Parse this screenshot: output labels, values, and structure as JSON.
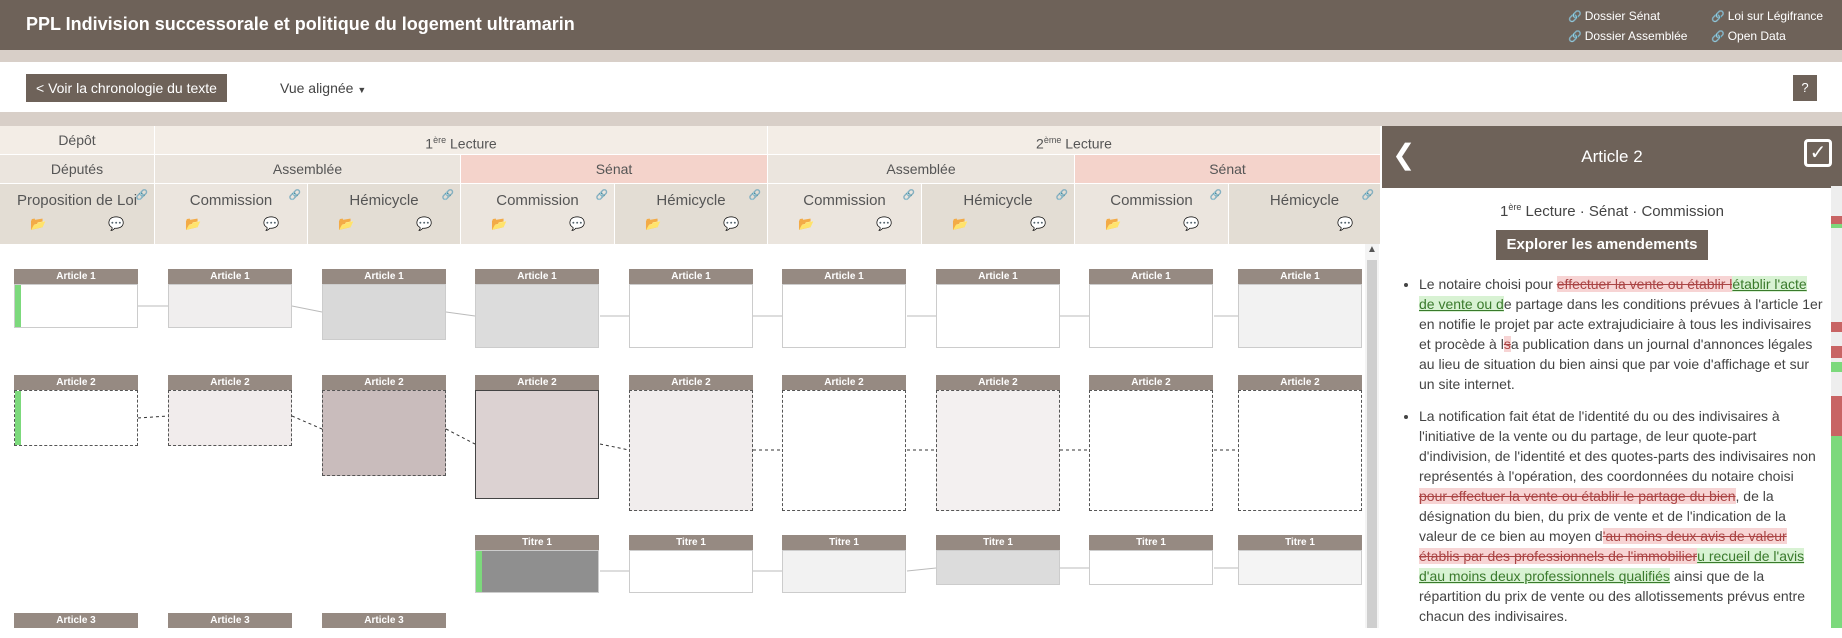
{
  "header": {
    "title": "PPL Indivision successorale et politique du logement ultramarin",
    "links": [
      "Dossier Sénat",
      "Dossier Assemblée",
      "Loi sur Légifrance",
      "Open Data"
    ]
  },
  "toolbar": {
    "back_label": "< Voir la chronologie du texte",
    "view_label": "Vue alignée",
    "help_label": "?"
  },
  "columns": {
    "row1": [
      {
        "label": "Dépôt"
      },
      {
        "label": "1ère Lecture",
        "base": "1",
        "sup": "ère",
        "rest": " Lecture"
      },
      {
        "label": "2ème Lecture",
        "base": "2",
        "sup": "ème",
        "rest": " Lecture"
      }
    ],
    "row2": [
      "Députés",
      "Assemblée",
      "Sénat",
      "Assemblée",
      "Sénat"
    ],
    "row3": [
      "Proposition de Loi",
      "Commission",
      "Hémicycle",
      "Commission",
      "Hémicycle",
      "Commission",
      "Hémicycle",
      "Commission",
      "Hémicycle"
    ]
  },
  "grid": {
    "article1": "Article 1",
    "article2": "Article 2",
    "titre1": "Titre 1",
    "article3": "Article 3"
  },
  "panel": {
    "title": "Article 2",
    "subtitle_base": "1",
    "subtitle_sup": "ère",
    "subtitle_rest": " Lecture · Sénat · Commission",
    "explore_label": "Explorer les amendements",
    "p1": {
      "a": "Le notaire choisi pour ",
      "del1": "effectuer la vente ou établir l",
      "ins1": "établir l'acte de vente ou d",
      "b": "e partage dans les conditions prévues à l'article 1er en notifie le projet par acte extrajudiciaire à tous les indivisaires et procède à l",
      "del2": "s",
      "c": "a publication dans un journal d'annonces légales au lieu de situation du bien ainsi que par voie d'affichage et sur un site internet."
    },
    "p2": {
      "a": "La notification fait état de l'identité du ou des indivisaires à l'initiative de la vente ou du partage, de leur quote-part d'indivision, de l'identité et des quotes-parts des indivisaires non représentés à l'opération, des coordonnées du notaire choisi",
      "del1": " pour effectuer la vente ou établir le partage du bien",
      "b": ", de la désignation du bien, du prix de vente et de l'indication de la valeur de ce bien au moyen d",
      "del2": "'au moins deux avis de valeur établis par des professionnels de l'immobilier",
      "ins1": "u recueil de l'avis d'au moins deux professionnels qualifiés",
      "c": " ainsi que de la répartition du prix de vente ou des allotissements prévus entre chacun des indivisaires."
    }
  },
  "colors": {
    "brand": "#6e6259",
    "senat": "#f4d3cb",
    "inserted": "#7cd97c",
    "deleted": "#c86464"
  }
}
